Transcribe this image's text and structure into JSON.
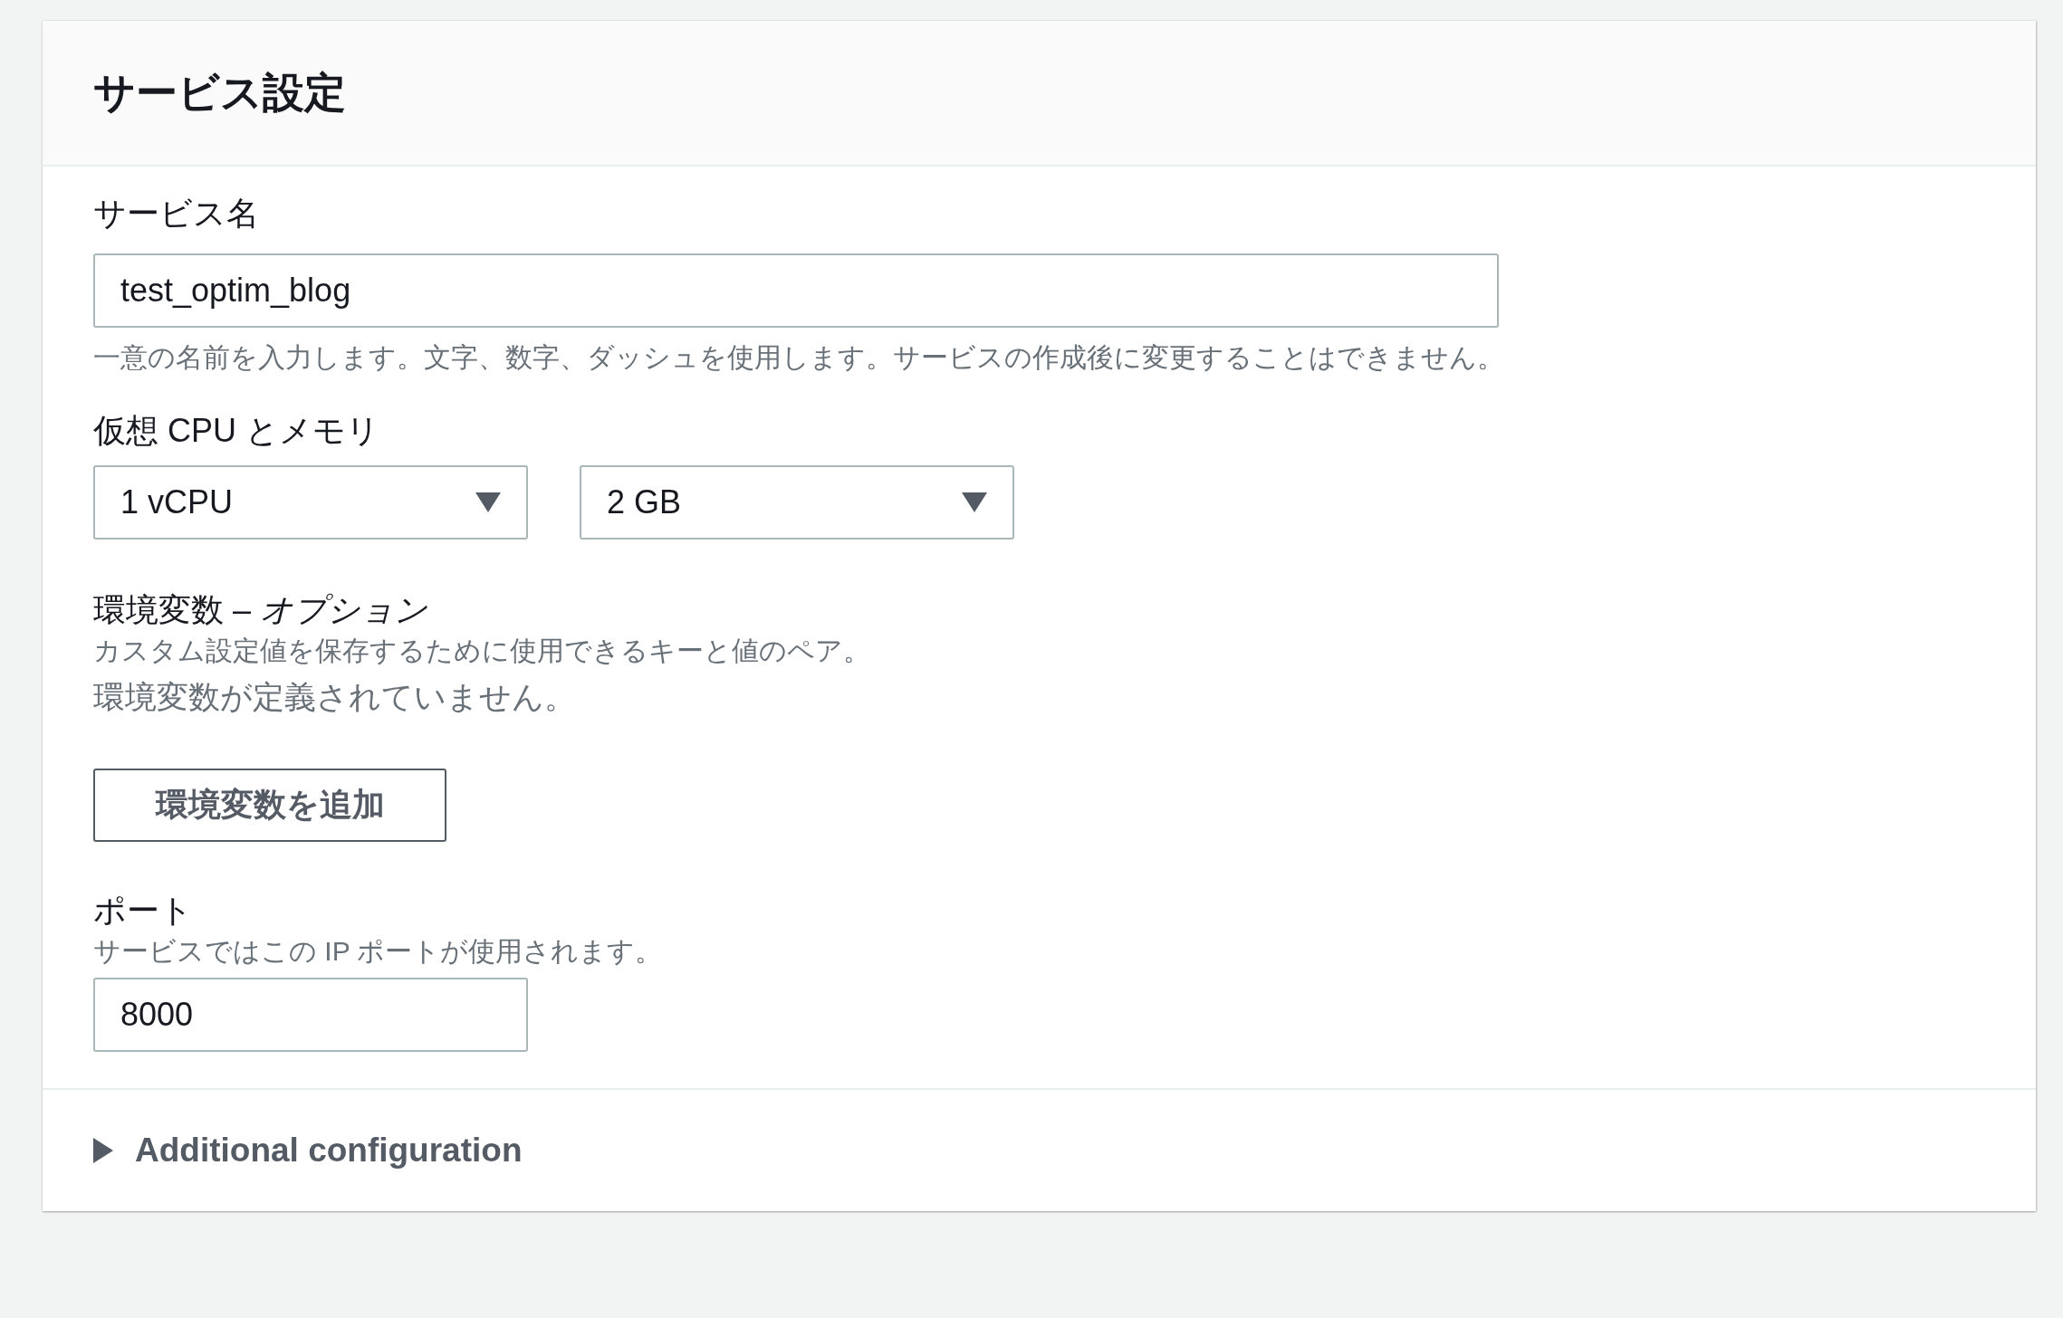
{
  "panel": {
    "title": "サービス設定"
  },
  "service_name": {
    "label": "サービス名",
    "value": "test_optim_blog",
    "hint": "一意の名前を入力します。文字、数字、ダッシュを使用します。サービスの作成後に変更することはできません。"
  },
  "compute": {
    "label": "仮想 CPU とメモリ",
    "selects": [
      {
        "value": "1 vCPU"
      },
      {
        "value": "2 GB"
      }
    ]
  },
  "env": {
    "label": "環境変数 – *オプション*",
    "description": "カスタム設定値を保存するために使用できるキーと値のペア。",
    "empty_message": "環境変数が定義されていません。",
    "add_button": "環境変数を追加"
  },
  "port": {
    "label": "ポート",
    "description": "サービスではこの IP ポートが使用されます。",
    "value": "8000"
  },
  "additional": {
    "label": "Additional configuration",
    "expanded": false
  }
}
